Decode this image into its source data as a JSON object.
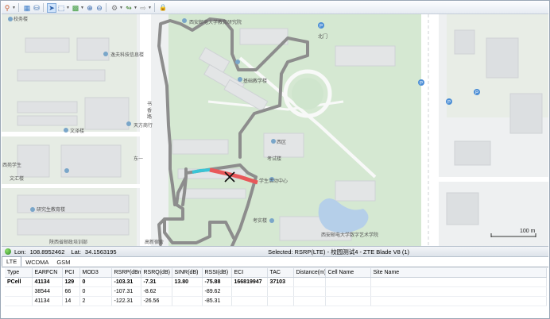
{
  "toolbar": {
    "items": [
      {
        "icon": "pin-icon",
        "glyph": "⚲",
        "dropdown": true
      },
      {
        "icon": "layers-icon",
        "glyph": "▦",
        "dropdown": false
      },
      {
        "icon": "database-icon",
        "glyph": "⛁",
        "dropdown": false
      },
      {
        "icon": "pointer-icon",
        "glyph": "➤",
        "dropdown": false
      },
      {
        "icon": "select-icon",
        "glyph": "⬚",
        "dropdown": true
      },
      {
        "icon": "grid-icon",
        "glyph": "▩",
        "dropdown": true
      },
      {
        "icon": "zoom-in-icon",
        "glyph": "⊕",
        "dropdown": false
      },
      {
        "icon": "zoom-out-icon",
        "glyph": "⊖",
        "dropdown": false
      },
      {
        "icon": "settings-icon",
        "glyph": "⚙",
        "dropdown": true
      },
      {
        "icon": "route-icon",
        "glyph": "↬",
        "dropdown": true
      },
      {
        "icon": "forward-icon",
        "glyph": "⇨",
        "dropdown": true
      },
      {
        "icon": "lock-icon",
        "glyph": "🔒",
        "dropdown": false
      }
    ]
  },
  "map": {
    "labels": {
      "campus_building": "校务楼",
      "tech_info": "逸夫科技信息楼",
      "research_building": "西安邮电大学教育研究院",
      "science_building": "基础教学楼",
      "shuxiang_road_1": "书",
      "shuxiang_road_2": "香",
      "shuxiang_road_3": "路",
      "tianfang": "天方商行",
      "wenze": "文泽楼",
      "west_district": "西区",
      "dongyi": "东一",
      "xiyuan_student": "西苑学生",
      "kaiyu": "考试楼",
      "student_center": "学生活动中心",
      "wenhui": "文汇楼",
      "research_building2": "研究生教育楼",
      "kaoshi": "考实楼",
      "xiyou_art": "西安邮电大学数字艺术学院",
      "shaanxi_post": "陕西省邮政培训部",
      "gaoxin": "高新宿舍",
      "north_gate": "北门"
    },
    "scale_label": "100 m"
  },
  "status": {
    "lon_label": "Lon:",
    "lon_value": "108.8952462",
    "lat_label": "Lat:",
    "lat_value": "34.1563195",
    "selected": "Selected: RSRP(LTE) - 校园测试4 - ZTE Blade V8 (1)"
  },
  "tabs": [
    "LTE",
    "WCDMA",
    "GSM"
  ],
  "table": {
    "headers": [
      "Type",
      "EARFCN",
      "PCI",
      "MOD3",
      "RSRP(dBm)",
      "RSRQ(dB)",
      "SINR(dB)",
      "RSSI(dB)",
      "ECI",
      "TAC",
      "Distance(m)",
      "Cell Name",
      "Site Name"
    ],
    "rows": [
      [
        "PCell",
        "41134",
        "129",
        "0",
        "-103.31",
        "-7.31",
        "13.80",
        "-75.88",
        "166819947",
        "37103",
        "",
        "",
        ""
      ],
      [
        "",
        "38544",
        "66",
        "0",
        "-107.31",
        "-8.62",
        "",
        "-89.62",
        "",
        "",
        "",
        "",
        ""
      ],
      [
        "",
        "41134",
        "14",
        "2",
        "-122.31",
        "-26.56",
        "",
        "-85.31",
        "",
        "",
        "",
        "",
        ""
      ]
    ]
  },
  "colors": {
    "track": "#7f7f7f",
    "rsrp_bad": "#e8585a",
    "rsrp_mid": "#39c5d6",
    "green": "#cfe5cd",
    "water": "#b5cfe9"
  }
}
